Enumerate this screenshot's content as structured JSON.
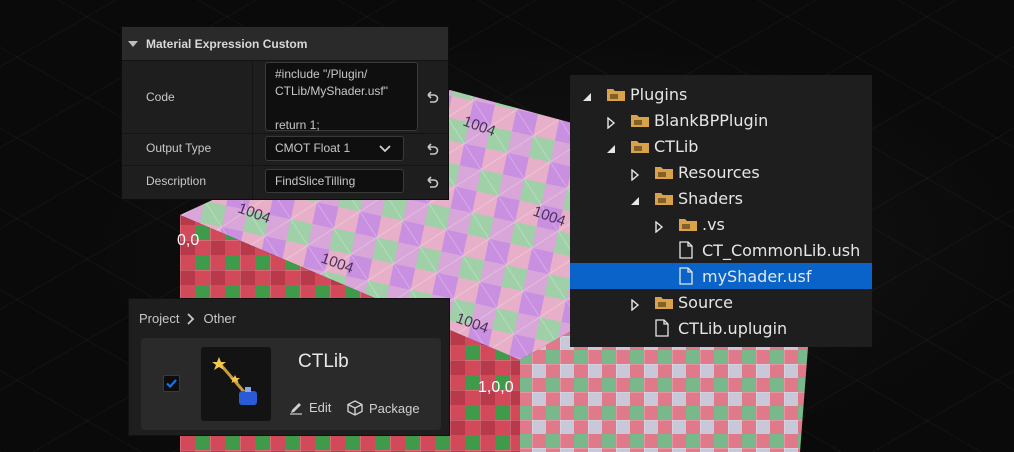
{
  "colors": {
    "panel_bg": "#1e1e1e",
    "header_bg": "#2a2a2a",
    "selection": "#0a63c8",
    "folder": "#d9a24a",
    "checkbox": "#1a73e8"
  },
  "material_panel": {
    "title": "Material Expression Custom",
    "rows": [
      {
        "label": "Code",
        "value_lines": [
          "#include \"/Plugin/",
          "CTLib/MyShader.usf\"",
          "",
          "return 1;"
        ],
        "reset_icon": "reset-arrow-icon"
      },
      {
        "label": "Output Type",
        "value": "CMOT Float 1",
        "reset_icon": "reset-arrow-icon"
      },
      {
        "label": "Description",
        "value": "FindSliceTilling",
        "reset_icon": "reset-arrow-icon"
      }
    ]
  },
  "tree": {
    "items": [
      {
        "label": "Plugins",
        "depth": 0,
        "expanded": true,
        "type": "folder"
      },
      {
        "label": "BlankBPPlugin",
        "depth": 1,
        "expanded": false,
        "type": "folder"
      },
      {
        "label": "CTLib",
        "depth": 1,
        "expanded": true,
        "type": "folder"
      },
      {
        "label": "Resources",
        "depth": 2,
        "expanded": false,
        "type": "folder"
      },
      {
        "label": "Shaders",
        "depth": 2,
        "expanded": true,
        "type": "folder"
      },
      {
        "label": ".vs",
        "depth": 3,
        "expanded": false,
        "type": "folder"
      },
      {
        "label": "CT_CommonLib.ush",
        "depth": 3,
        "type": "file"
      },
      {
        "label": "myShader.usf",
        "depth": 3,
        "type": "file",
        "selected": true
      },
      {
        "label": "Source",
        "depth": 2,
        "expanded": false,
        "type": "folder"
      },
      {
        "label": "CTLib.uplugin",
        "depth": 2,
        "type": "file"
      }
    ]
  },
  "plugin_browser": {
    "breadcrumb": [
      "Project",
      "Other"
    ],
    "plugin": {
      "name": "CTLib",
      "enabled": true,
      "edit_label": "Edit",
      "package_label": "Package"
    }
  },
  "cube_labels": [
    "1004",
    "1004",
    "1004",
    "1004",
    "1004",
    "1004",
    "1,0,0",
    "0,0"
  ]
}
